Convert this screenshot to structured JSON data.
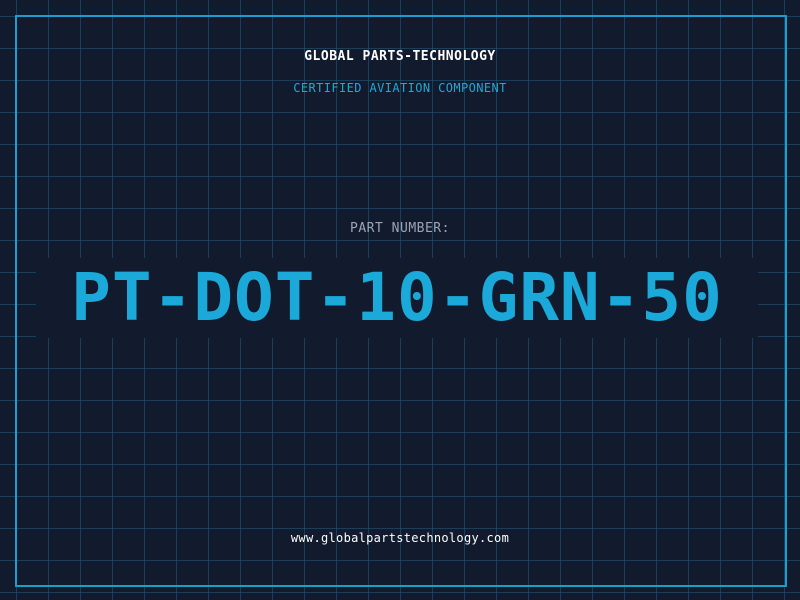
{
  "header": {
    "company": "GLOBAL PARTS-TECHNOLOGY",
    "subtitle": "CERTIFIED AVIATION COMPONENT"
  },
  "part": {
    "label": "PART NUMBER:",
    "number": "PT-DOT-10-GRN-50"
  },
  "footer": {
    "url": "www.globalpartstechnology.com"
  },
  "colors": {
    "background": "#121a2e",
    "grid": "#1a5f82",
    "frame": "#1d9ccd",
    "accent": "#1aa9d8",
    "label": "#9aa6b6",
    "text": "#ffffff"
  }
}
